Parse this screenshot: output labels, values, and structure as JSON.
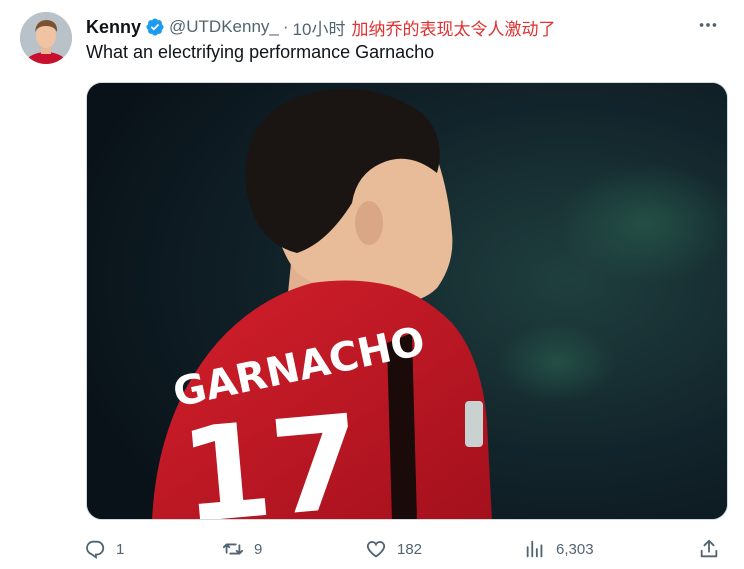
{
  "tweet": {
    "display_name": "Kenny",
    "handle": "@UTDKenny_",
    "separator": "·",
    "time": "10小时",
    "annotation": "加纳乔的表现太令人激动了",
    "text": "What an electrifying performance Garnacho",
    "media": {
      "jersey_name": "GARNACHO",
      "jersey_number": "17"
    },
    "stats": {
      "replies": "1",
      "retweets": "9",
      "likes": "182",
      "views": "6,303"
    }
  },
  "icons": {
    "verified": "verified-badge-icon",
    "more": "more-options-icon",
    "reply": "reply-icon",
    "retweet": "retweet-icon",
    "like": "heart-icon",
    "views": "views-bar-chart-icon",
    "share": "share-icon"
  },
  "colors": {
    "verified": "#1d9bf0",
    "annotation": "#e0302f",
    "secondary_text": "#536471",
    "primary_text": "#0f1419",
    "jersey_red": "#c8102e"
  }
}
